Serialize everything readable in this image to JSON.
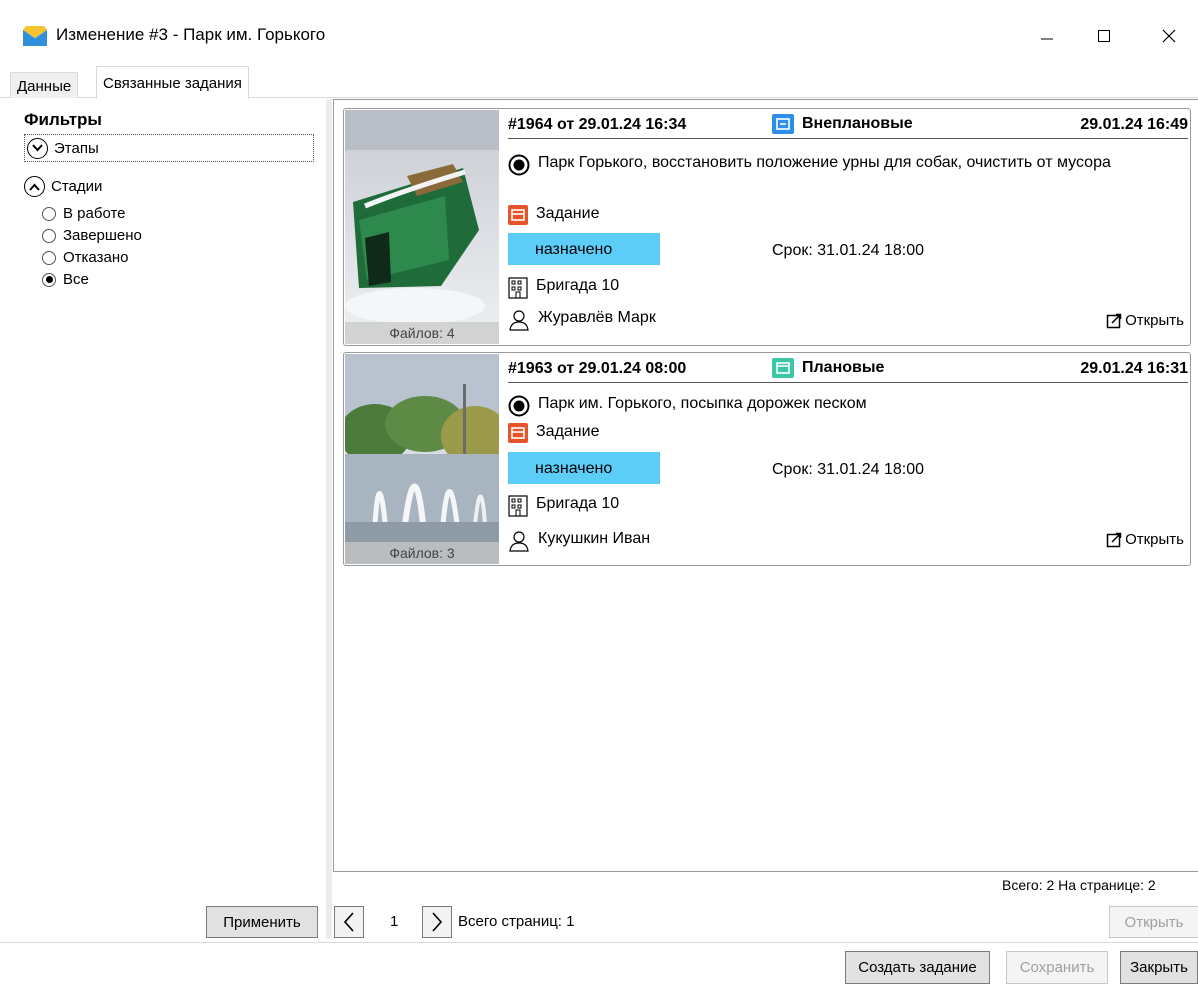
{
  "window": {
    "title": "Изменение #3 - Парк им. Горького"
  },
  "tabs": [
    {
      "label": "Данные"
    },
    {
      "label": "Связанные задания"
    }
  ],
  "filters": {
    "title": "Фильтры",
    "stages_label": "Этапы",
    "statuses_label": "Стадии",
    "options": [
      {
        "label": "В работе",
        "checked": false
      },
      {
        "label": "Завершено",
        "checked": false
      },
      {
        "label": "Отказано",
        "checked": false
      },
      {
        "label": "Все",
        "checked": true
      }
    ],
    "apply_label": "Применить"
  },
  "cards": [
    {
      "number": "#1964  от  29.01.24 16:34",
      "type": "Внеплановые",
      "type_color": "#2e8ee8",
      "updated": "29.01.24 16:49",
      "description": "Парк Горького, восстановить положение урны для собак, очистить от мусора",
      "kind": "Задание",
      "status": "назначено",
      "deadline": "Срок: 31.01.24 18:00",
      "team": "Бригада 10",
      "person": "Журавлёв Марк",
      "files": "Файлов: 4",
      "open_label": "Открыть"
    },
    {
      "number": "#1963  от  29.01.24 08:00",
      "type": "Плановые",
      "type_color": "#3cc8a8",
      "updated": "29.01.24 16:31",
      "description": "Парк им. Горького, посыпка дорожек песком",
      "kind": "Задание",
      "status": "назначено",
      "deadline": "Срок: 31.01.24 18:00",
      "team": "Бригада 10",
      "person": "Кукушкин Иван",
      "files": "Файлов: 3",
      "open_label": "Открыть"
    }
  ],
  "pager": {
    "totals": "Всего: 2  На странице: 2",
    "page": "1",
    "pages_total": "Всего страниц: 1",
    "open_label": "Открыть"
  },
  "actions": {
    "create_label": "Создать задание",
    "save_label": "Сохранить",
    "close_label": "Закрыть"
  },
  "colors": {
    "status_badge": "#5bcdf7",
    "task_icon": "#e8542a"
  }
}
